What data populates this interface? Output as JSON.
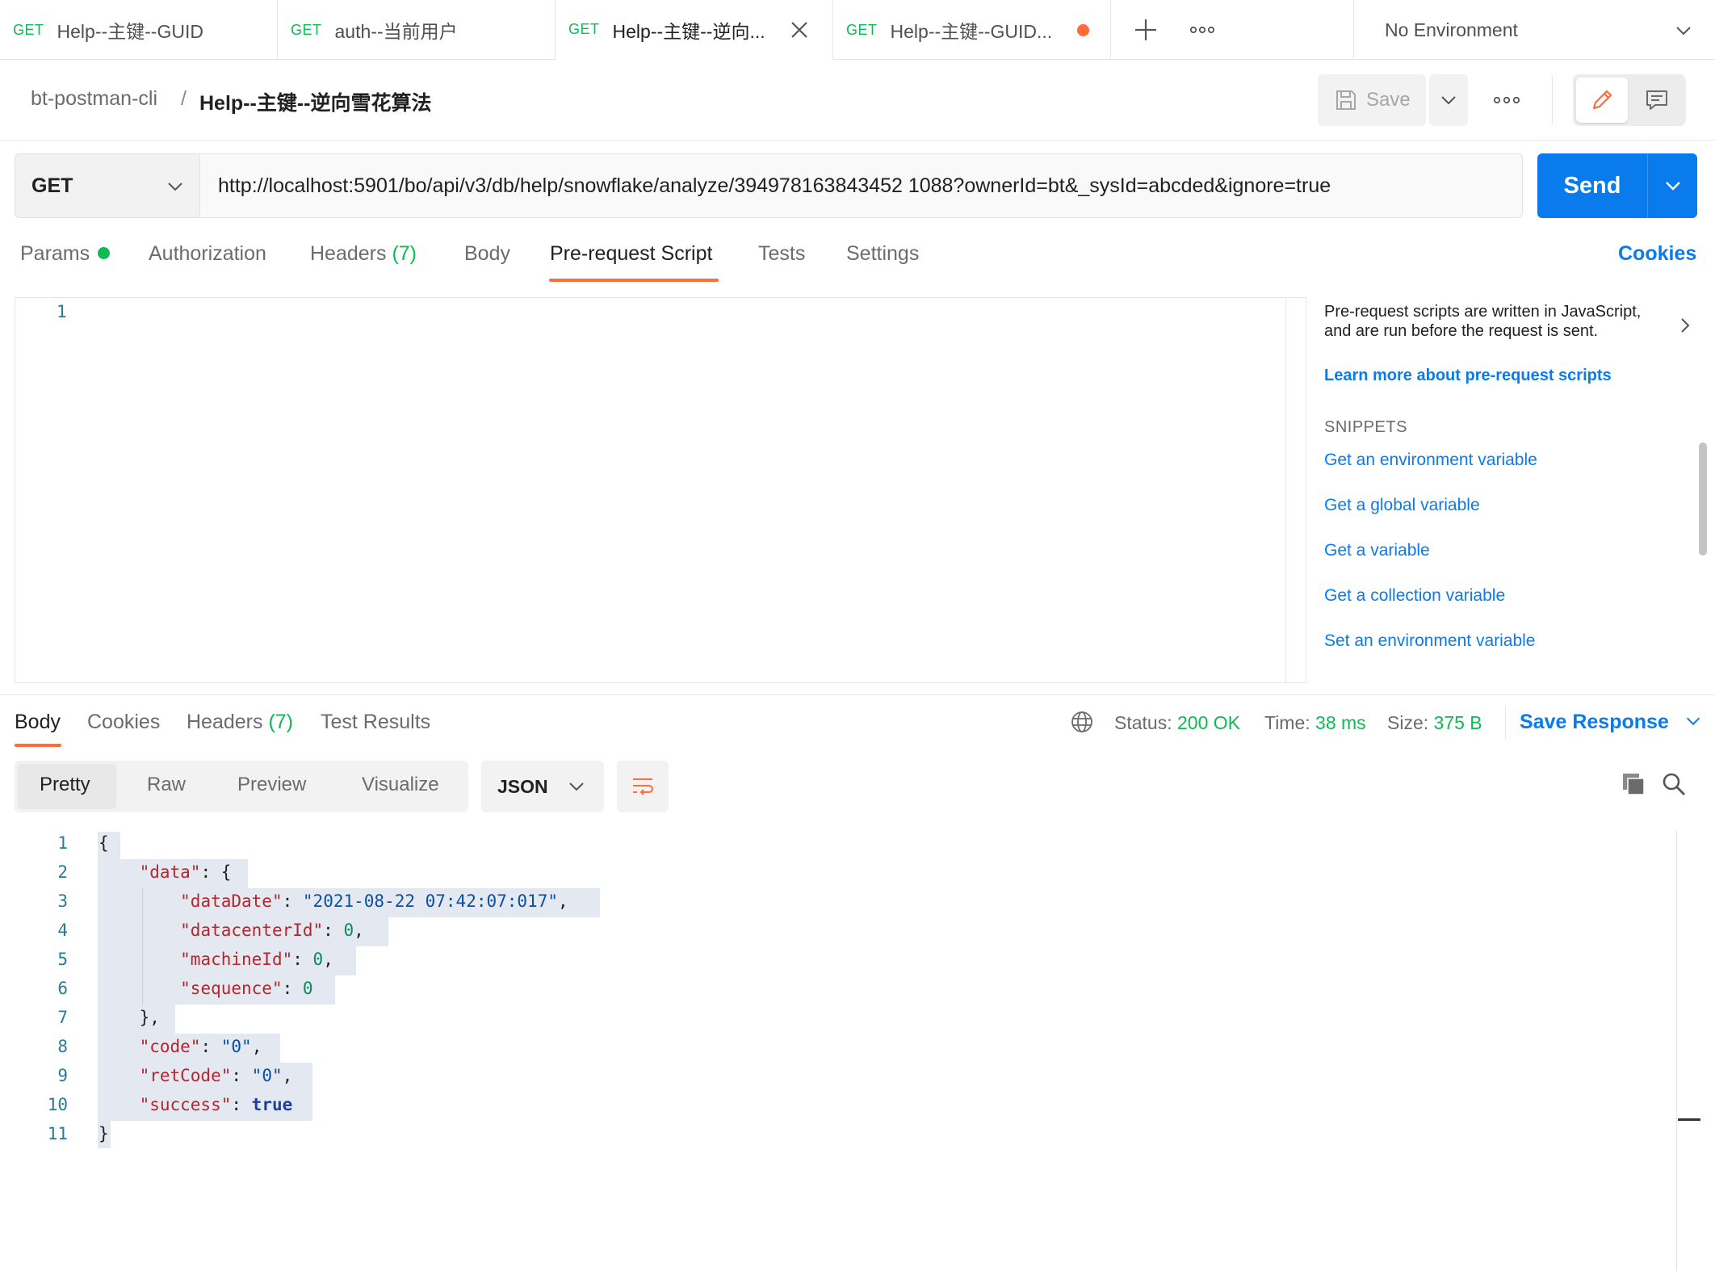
{
  "tabs": [
    {
      "method": "GET",
      "label": "Help--主键--GUID",
      "state": "normal"
    },
    {
      "method": "GET",
      "label": "auth--当前用户",
      "state": "normal"
    },
    {
      "method": "GET",
      "label": "Help--主键--逆向...",
      "state": "active"
    },
    {
      "method": "GET",
      "label": "Help--主键--GUID...",
      "state": "unsaved"
    }
  ],
  "environment": {
    "label": "No Environment"
  },
  "header": {
    "collection": "bt-postman-cli",
    "separator": "/",
    "request_name": "Help--主键--逆向雪花算法",
    "save_label": "Save"
  },
  "request": {
    "method": "GET",
    "url": "http://localhost:5901/bo/api/v3/db/help/snowflake/analyze/394978163843452 1088?ownerId=bt&_sysId=abcded&ignore=true",
    "send_label": "Send"
  },
  "request_tabs": [
    {
      "label": "Params"
    },
    {
      "label": "Authorization"
    },
    {
      "label": "Headers",
      "count": "(7)"
    },
    {
      "label": "Body"
    },
    {
      "label": "Pre-request Script"
    },
    {
      "label": "Tests"
    },
    {
      "label": "Settings"
    }
  ],
  "cookies_label": "Cookies",
  "editor": {
    "line_numbers": [
      "1"
    ]
  },
  "side_panel": {
    "description": "Pre-request scripts are written in JavaScript, and are run before the request is sent.",
    "learn_more": "Learn more about pre-request scripts",
    "snippets_heading": "SNIPPETS",
    "snippets": [
      "Get an environment variable",
      "Get a global variable",
      "Get a variable",
      "Get a collection variable",
      "Set an environment variable"
    ]
  },
  "response_tabs": [
    {
      "label": "Body"
    },
    {
      "label": "Cookies"
    },
    {
      "label": "Headers",
      "count": "(7)"
    },
    {
      "label": "Test Results"
    }
  ],
  "response_status": {
    "status_label": "Status:",
    "status_value": "200 OK",
    "time_label": "Time:",
    "time_value": "38 ms",
    "size_label": "Size:",
    "size_value": "375 B",
    "save_response": "Save Response"
  },
  "response_view": {
    "options": [
      "Pretty",
      "Raw",
      "Preview",
      "Visualize"
    ],
    "selected": "Pretty",
    "format": "JSON"
  },
  "response_body": {
    "line_numbers": [
      "1",
      "2",
      "3",
      "4",
      "5",
      "6",
      "7",
      "8",
      "9",
      "10",
      "11"
    ],
    "data_date": "2021-08-22 07:42:07:017",
    "datacenter_id": "0",
    "machine_id": "0",
    "sequence": "0",
    "code": "0",
    "ret_code": "0",
    "success": "true"
  },
  "colors": {
    "accent": "#ff6c37",
    "primary": "#097bed",
    "success": "#0cbb52"
  }
}
